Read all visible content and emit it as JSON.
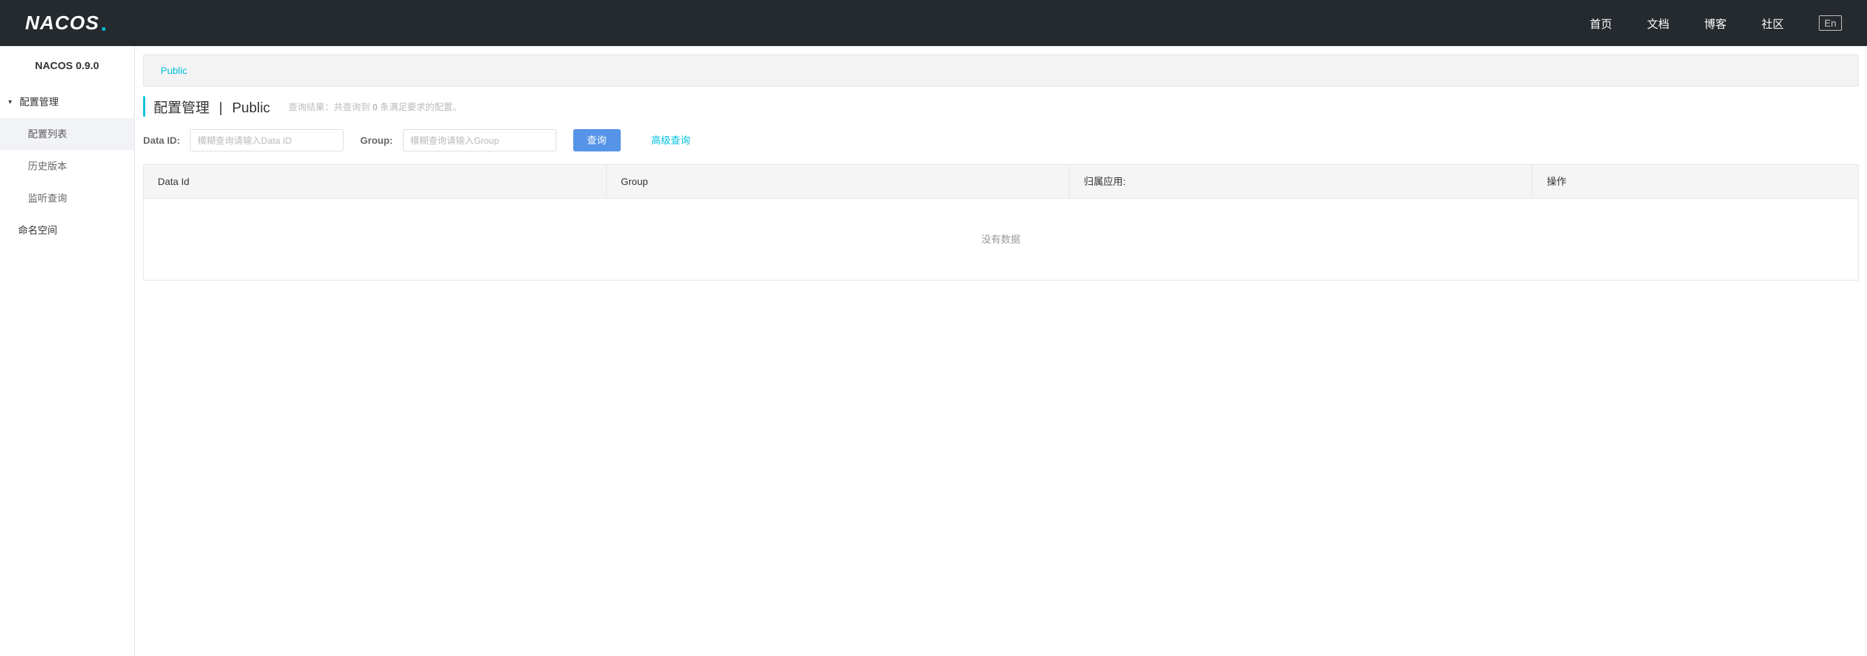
{
  "header": {
    "logo": "NACOS",
    "nav": {
      "home": "首页",
      "docs": "文档",
      "blog": "博客",
      "community": "社区"
    },
    "lang": "En"
  },
  "sidebar": {
    "title": "NACOS 0.9.0",
    "menu": {
      "config": {
        "label": "配置管理",
        "children": {
          "list": "配置列表",
          "history": "历史版本",
          "listener": "监听查询"
        }
      },
      "namespace": "命名空间"
    }
  },
  "tabs": {
    "public": "Public"
  },
  "page": {
    "title_main": "配置管理",
    "title_sep": "|",
    "title_sub": "Public",
    "hint_prefix": "查询结果：共查询到 ",
    "hint_count": "0",
    "hint_suffix": " 条满足要求的配置。"
  },
  "search": {
    "dataid_label": "Data ID:",
    "dataid_placeholder": "模糊查询请输入Data ID",
    "group_label": "Group:",
    "group_placeholder": "模糊查询请输入Group",
    "query_btn": "查询",
    "advanced": "高级查询"
  },
  "table": {
    "col_dataid": "Data Id",
    "col_group": "Group",
    "col_app": "归属应用:",
    "col_op": "操作",
    "empty": "没有数据"
  }
}
